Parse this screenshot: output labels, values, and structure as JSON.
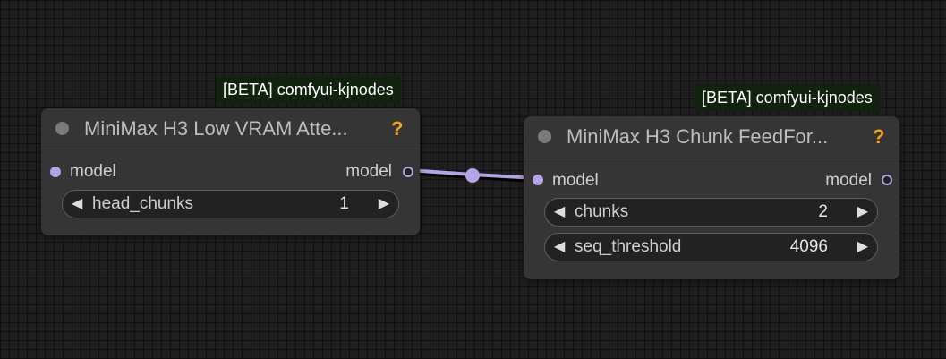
{
  "canvas": {
    "background": "#1f1f1f",
    "link_color": "#b5a3e8"
  },
  "nodes": [
    {
      "badge": "[BETA] comfyui-kjnodes",
      "title": "MiniMax H3 Low VRAM Atte...",
      "help": "?",
      "input_label": "model",
      "output_label": "model",
      "widgets": [
        {
          "label": "head_chunks",
          "value": "1"
        }
      ]
    },
    {
      "badge": "[BETA] comfyui-kjnodes",
      "title": "MiniMax H3 Chunk FeedFor...",
      "help": "?",
      "input_label": "model",
      "output_label": "model",
      "widgets": [
        {
          "label": "chunks",
          "value": "2"
        },
        {
          "label": "seq_threshold",
          "value": "4096"
        }
      ]
    }
  ]
}
